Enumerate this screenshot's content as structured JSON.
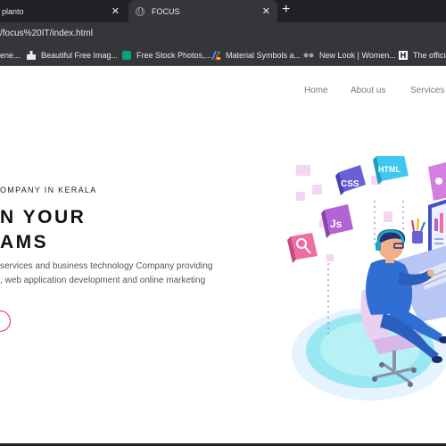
{
  "browser": {
    "tabs": [
      {
        "title": "planto",
        "active": false
      },
      {
        "title": "FOCUS",
        "active": true
      }
    ],
    "close_glyph": "✕",
    "new_tab_glyph": "+",
    "url": "/focus%20IT/index.html",
    "bookmarks": [
      {
        "label": "ene...",
        "icon": "bookmark-icon"
      },
      {
        "label": "Beautiful Free Imag...",
        "icon": "unsplash-icon"
      },
      {
        "label": "Free Stock Photos,...",
        "icon": "pexels-icon"
      },
      {
        "label": "Material Symbols a...",
        "icon": "google-fonts-icon"
      },
      {
        "label": "New Look | Women...",
        "icon": "newlook-icon"
      },
      {
        "label": "The officia",
        "icon": "h-logo-icon"
      }
    ]
  },
  "nav": {
    "items": [
      "Home",
      "About us",
      "Services"
    ]
  },
  "hero": {
    "eyebrow": "OMPANY IN KERALA",
    "headline_line1": "N YOUR",
    "headline_line2": "AMS",
    "description_line1": "services and business technology Company providing",
    "description_line2": ", web application development and online marketing",
    "illustration_labels": {
      "css": "CSS",
      "html": "HTML",
      "js": "Js"
    }
  },
  "colors": {
    "tab_bar": "#202124",
    "toolbar": "#35363a",
    "accent": "#e0324c",
    "illustration_blue": "#2f6fd3"
  }
}
